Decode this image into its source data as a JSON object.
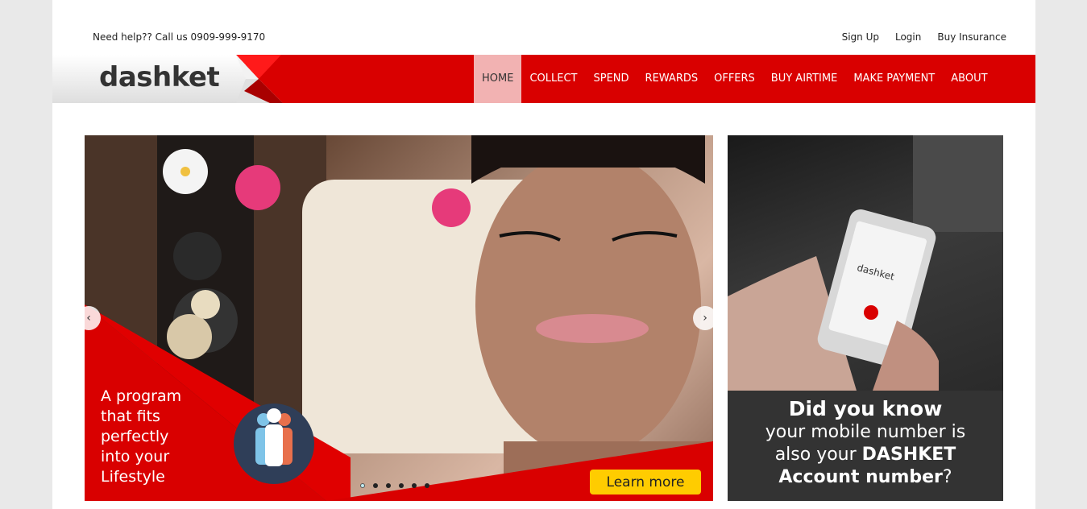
{
  "header": {
    "help_text": "Need help?? Call us 0909-999-9170",
    "top_links": [
      "Sign Up",
      "Login",
      "Buy Insurance"
    ]
  },
  "brand": {
    "logo_text": "dashket",
    "accent_color": "#d90000"
  },
  "nav": {
    "items": [
      "HOME",
      "COLLECT",
      "SPEND",
      "REWARDS",
      "OFFERS",
      "BUY AIRTIME",
      "MAKE PAYMENT",
      "ABOUT"
    ],
    "active": "HOME"
  },
  "slider": {
    "promo_line1": "A program",
    "promo_line2": "that fits",
    "promo_line3": "perfectly",
    "promo_line4": "into your",
    "promo_line5": "Lifestyle",
    "cta_label": "Learn more",
    "slide_count": 6,
    "active_slide": 1,
    "prev_icon": "chevron-left-icon",
    "next_icon": "chevron-right-icon"
  },
  "side_banner": {
    "phone_logo_text": "dashket",
    "line1": "Did you know",
    "line2": "your mobile number is",
    "line3_prefix": "also your ",
    "line3_bold": "DASHKET",
    "line4_bold": "Account number",
    "line4_suffix": "?"
  }
}
